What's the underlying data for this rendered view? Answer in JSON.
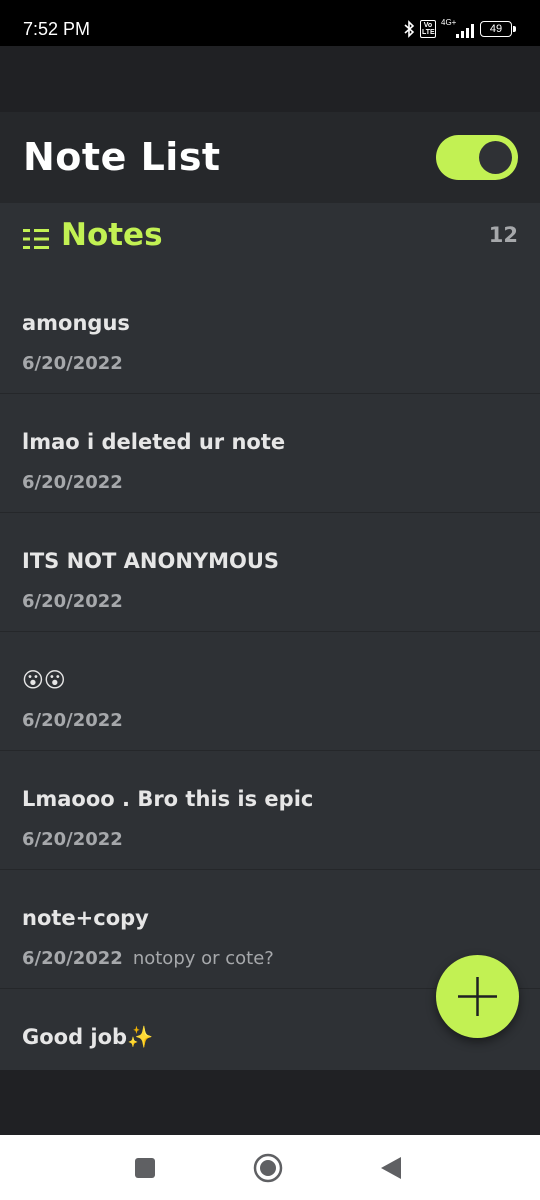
{
  "status_bar": {
    "time": "7:52 PM",
    "volte": "Vo LTE",
    "network": "4G+",
    "battery": "49"
  },
  "header": {
    "title": "Note List",
    "theme_toggle_on": true
  },
  "section": {
    "title": "Notes",
    "count": "12"
  },
  "notes": [
    {
      "title": "amongus",
      "date": "6/20/2022",
      "preview": ""
    },
    {
      "title": "lmao i deleted ur note",
      "date": "6/20/2022",
      "preview": ""
    },
    {
      "title": "ITS NOT ANONYMOUS",
      "date": "6/20/2022",
      "preview": ""
    },
    {
      "title": "😮😮",
      "date": "6/20/2022",
      "preview": ""
    },
    {
      "title": "Lmaooo . Bro this is epic",
      "date": "6/20/2022",
      "preview": ""
    },
    {
      "title": "note+copy",
      "date": "6/20/2022",
      "preview": "notopy or cote?"
    },
    {
      "title": "Good job✨",
      "date": "",
      "preview": ""
    }
  ],
  "colors": {
    "accent": "#c2f153",
    "panel": "#2e3135",
    "header_bg": "#26282b",
    "background": "#202124"
  },
  "icons": {
    "fab": "plus-icon",
    "section": "list-icon",
    "nav": [
      "square-recents-icon",
      "circle-home-icon",
      "triangle-back-icon"
    ]
  }
}
